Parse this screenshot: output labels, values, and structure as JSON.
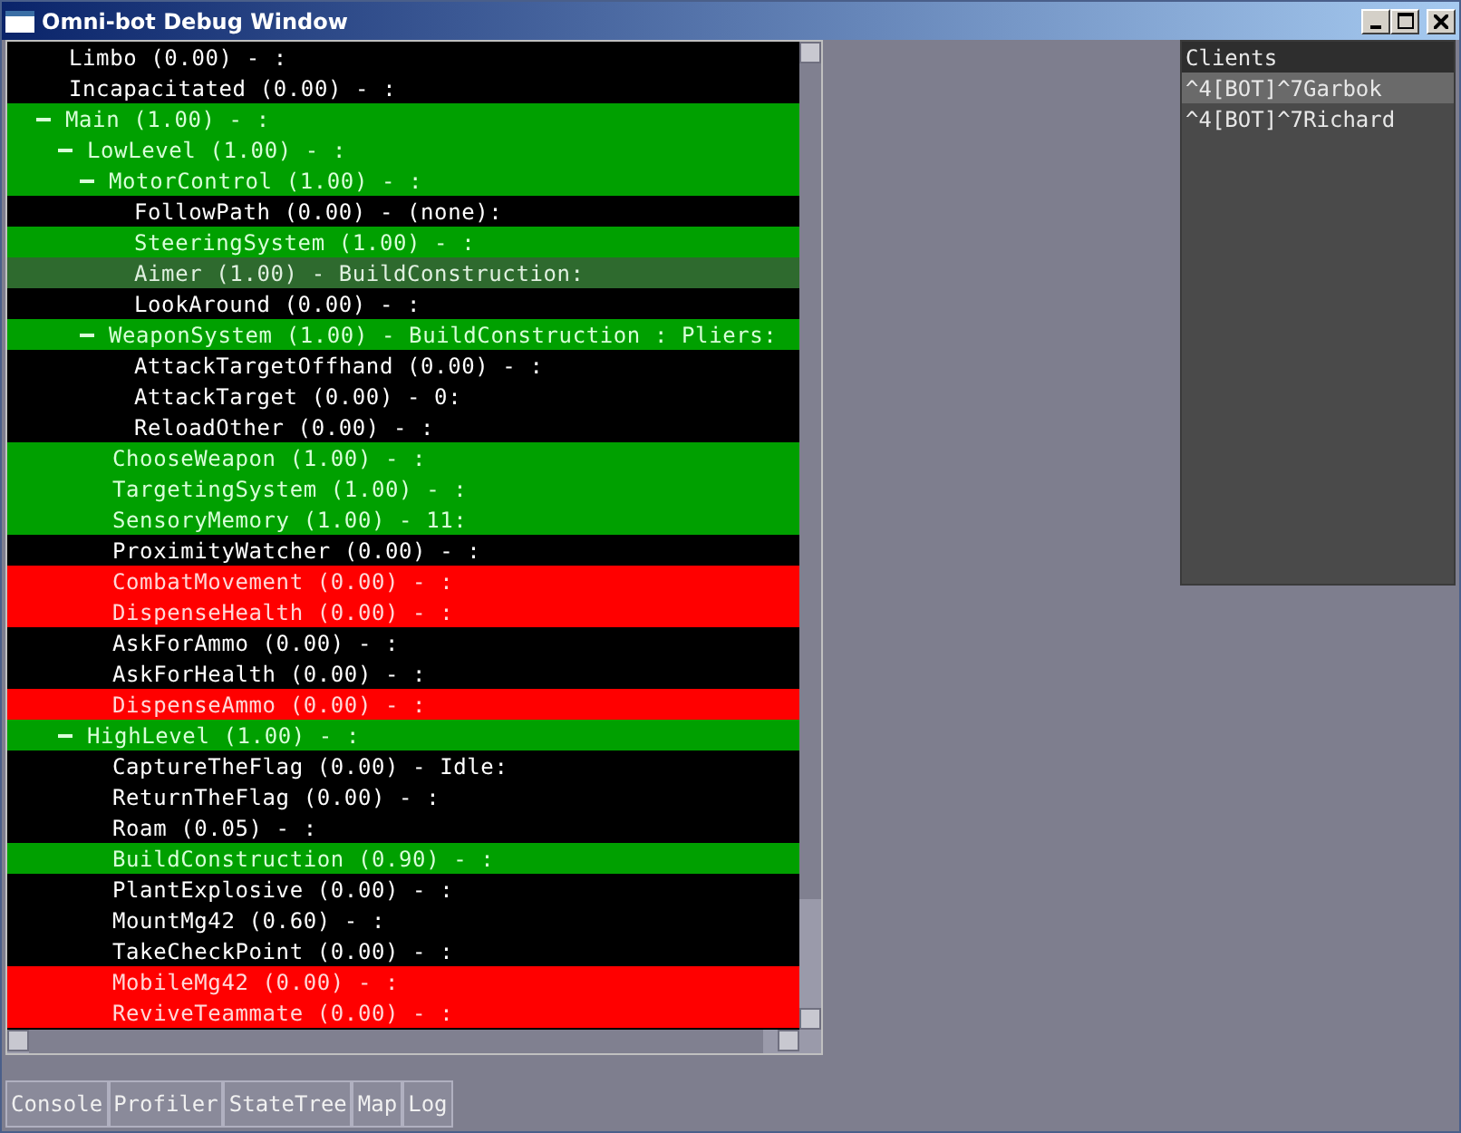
{
  "window": {
    "title": "Omni-bot Debug Window"
  },
  "state_tree": [
    {
      "label": "Limbo (0.00) - :",
      "kind": "inactive"
    },
    {
      "label": "Incapacitated (0.00) - :",
      "kind": "inactive"
    },
    {
      "label": "Main (1.00) - :",
      "kind": "active",
      "expanded": true,
      "children": [
        {
          "label": "LowLevel (1.00) - :",
          "kind": "active",
          "expanded": true,
          "children": [
            {
              "label": "MotorControl (1.00) - :",
              "kind": "active",
              "expanded": true,
              "children": [
                {
                  "label": "FollowPath (0.00) - (none):",
                  "kind": "inactive"
                },
                {
                  "label": "SteeringSystem (1.00) - :",
                  "kind": "active"
                },
                {
                  "label": "Aimer (1.00) - BuildConstruction:",
                  "kind": "focused"
                },
                {
                  "label": "LookAround (0.00) - :",
                  "kind": "inactive"
                }
              ]
            },
            {
              "label": "WeaponSystem (1.00) - BuildConstruction : Pliers:",
              "kind": "active",
              "expanded": true,
              "children": [
                {
                  "label": "AttackTargetOffhand (0.00) - :",
                  "kind": "inactive"
                },
                {
                  "label": "AttackTarget (0.00) - 0:",
                  "kind": "inactive"
                },
                {
                  "label": "ReloadOther (0.00) - :",
                  "kind": "inactive"
                }
              ]
            },
            {
              "label": "ChooseWeapon (1.00) - :",
              "kind": "active"
            },
            {
              "label": "TargetingSystem (1.00) - :",
              "kind": "active"
            },
            {
              "label": "SensoryMemory (1.00) - 11:",
              "kind": "active"
            },
            {
              "label": "ProximityWatcher (0.00) - :",
              "kind": "inactive"
            },
            {
              "label": "CombatMovement (0.00) - :",
              "kind": "disabled"
            },
            {
              "label": "DispenseHealth (0.00) - :",
              "kind": "disabled"
            },
            {
              "label": "AskForAmmo (0.00) - :",
              "kind": "inactive"
            },
            {
              "label": "AskForHealth (0.00) - :",
              "kind": "inactive"
            },
            {
              "label": "DispenseAmmo (0.00) - :",
              "kind": "disabled"
            }
          ]
        },
        {
          "label": "HighLevel (1.00) - :",
          "kind": "active",
          "expanded": true,
          "children": [
            {
              "label": "CaptureTheFlag (0.00) - Idle:",
              "kind": "inactive"
            },
            {
              "label": "ReturnTheFlag (0.00) - :",
              "kind": "inactive"
            },
            {
              "label": "Roam (0.05) - :",
              "kind": "inactive"
            },
            {
              "label": "BuildConstruction (0.90) - :",
              "kind": "active"
            },
            {
              "label": "PlantExplosive (0.00) - :",
              "kind": "inactive"
            },
            {
              "label": "MountMg42 (0.60) - :",
              "kind": "inactive"
            },
            {
              "label": "TakeCheckPoint (0.00) - :",
              "kind": "inactive"
            },
            {
              "label": "MobileMg42 (0.00) - :",
              "kind": "disabled"
            },
            {
              "label": "ReviveTeammate (0.00) - :",
              "kind": "disabled"
            }
          ]
        }
      ]
    }
  ],
  "clients": {
    "title": "Clients",
    "items": [
      {
        "label": "^4[BOT]^7Garbok",
        "selected": true
      },
      {
        "label": "^4[BOT]^7Richard",
        "selected": false
      }
    ]
  },
  "tabs": [
    {
      "label": "Console"
    },
    {
      "label": "Profiler"
    },
    {
      "label": "StateTree"
    },
    {
      "label": "Map"
    },
    {
      "label": "Log"
    }
  ]
}
